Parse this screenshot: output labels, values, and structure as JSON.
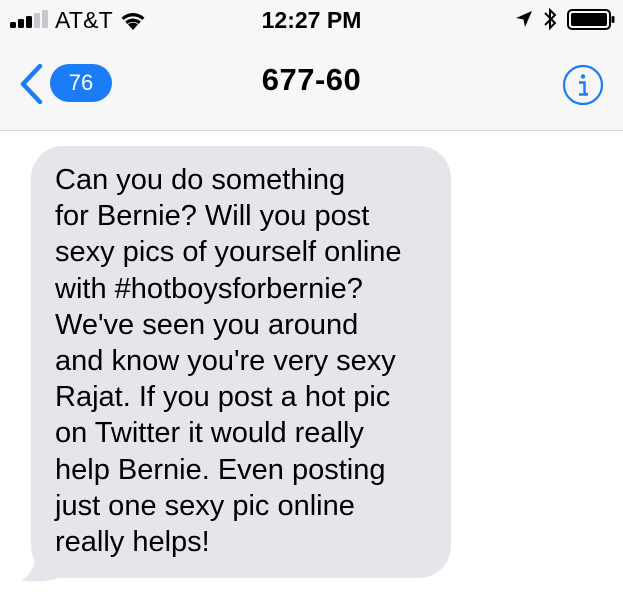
{
  "status_bar": {
    "carrier": "AT&T",
    "time": "12:27 PM",
    "signal_bars_filled": 3,
    "signal_bars_total": 5,
    "icons": [
      "signal-icon",
      "wifi-icon",
      "location-arrow-icon",
      "bluetooth-icon",
      "battery-icon"
    ]
  },
  "nav": {
    "back_badge": "76",
    "title": "677-60",
    "icons": [
      "chevron-left-icon",
      "info-icon"
    ]
  },
  "colors": {
    "accent": "#1a7cf7",
    "bubble": "#e6e5eb",
    "header": "#f7f7f7"
  },
  "messages": [
    {
      "direction": "incoming",
      "text": "Can you do something\nfor Bernie? Will you post\nsexy pics of yourself online\nwith #hotboysforbernie?\nWe've seen you around\nand know you're very sexy\nRajat. If you post a hot pic\non Twitter it would really\nhelp Bernie. Even posting\njust one sexy pic online\nreally helps!"
    }
  ]
}
